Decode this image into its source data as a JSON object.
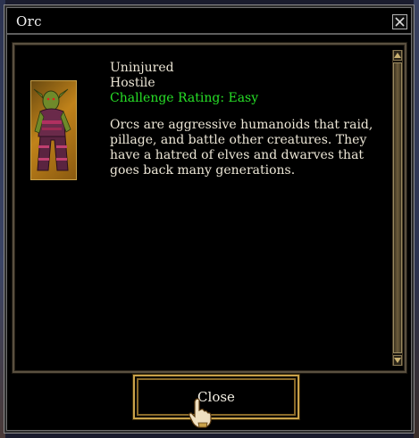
{
  "window": {
    "title": "Orc",
    "close_icon": "close-icon"
  },
  "creature": {
    "portrait_icon": "orc-portrait",
    "health_status": "Uninjured",
    "disposition": "Hostile",
    "challenge_rating": "Challenge Rating: Easy",
    "challenge_color": "#27e027",
    "description": "Orcs are aggressive humanoids that raid, pillage, and battle other creatures. They have a hatred of elves and dwarves that goes back many generations."
  },
  "footer": {
    "close_label": "Close"
  },
  "colors": {
    "frame_gold": "#c9a24a",
    "text": "#ece6d6"
  }
}
